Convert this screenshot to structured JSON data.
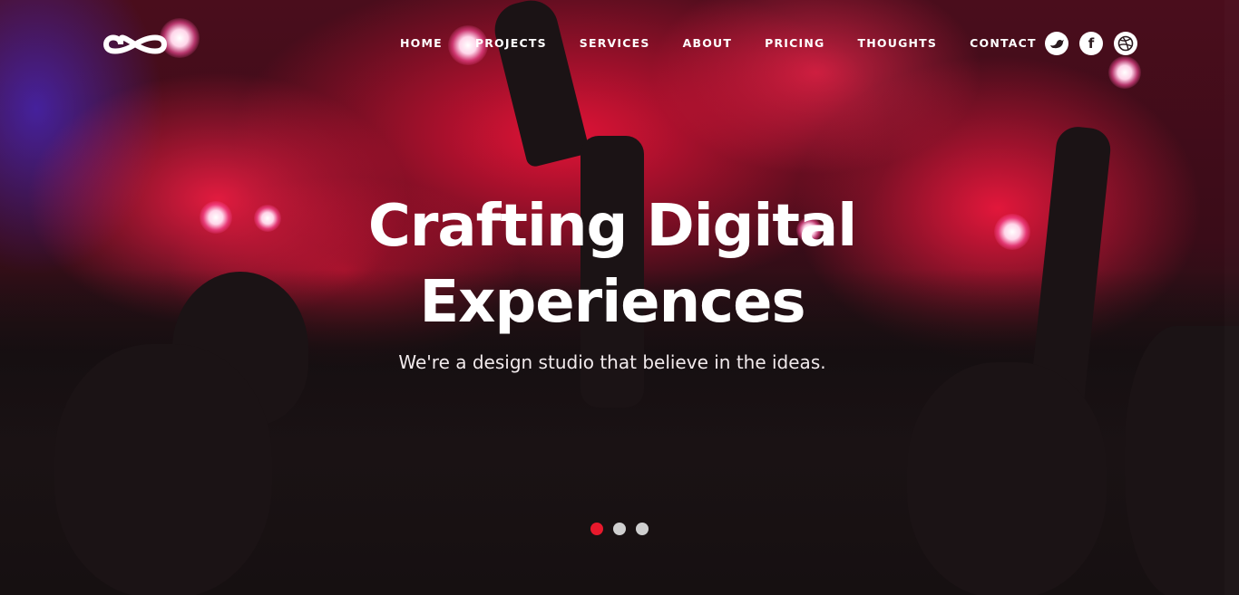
{
  "brand": {
    "logo_icon": "infinity-icon"
  },
  "nav": {
    "items": [
      "HOME",
      "PROJECTS",
      "SERVICES",
      "ABOUT",
      "PRICING",
      "THOUGHTS",
      "CONTACT"
    ]
  },
  "social": [
    {
      "icon": "twitter-bird-icon"
    },
    {
      "icon": "facebook-icon",
      "glyph": "f"
    },
    {
      "icon": "dribbble-icon"
    }
  ],
  "hero": {
    "title_line1": "Crafting Digital",
    "title_line2": "Experiences",
    "subtitle": "We're a design studio that believe in the ideas."
  },
  "slider": {
    "count": 3,
    "active_index": 0
  },
  "colors": {
    "accent": "#e8192c",
    "text": "#ffffff",
    "dot_inactive": "#cfcfcf"
  }
}
